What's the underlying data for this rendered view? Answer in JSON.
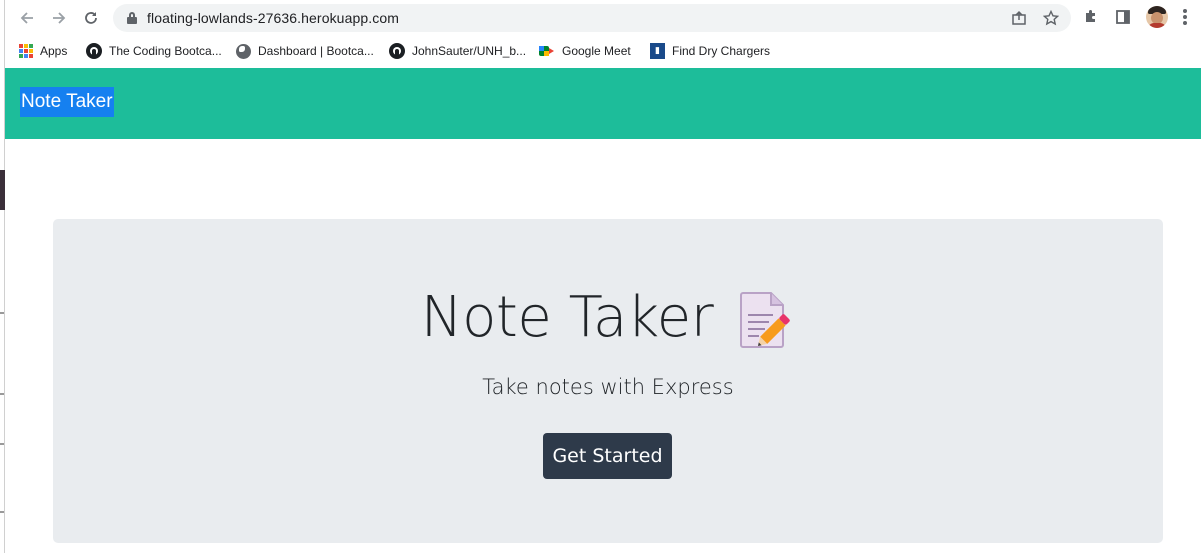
{
  "browser": {
    "url": "floating-lowlands-27636.herokuapp.com",
    "nav": {
      "back_icon": "back-arrow-icon",
      "forward_icon": "forward-arrow-icon",
      "reload_icon": "reload-icon"
    },
    "omnibox_icons": [
      "share-icon",
      "bookmark-star-icon"
    ],
    "toolbar_icons": [
      "extensions-icon",
      "side-panel-icon",
      "profile-avatar",
      "menu-icon"
    ]
  },
  "bookmarks": [
    {
      "label": "Apps",
      "icon": "apps-grid-icon"
    },
    {
      "label": "The Coding Bootca...",
      "icon": "github-icon"
    },
    {
      "label": "Dashboard | Bootca...",
      "icon": "globe-icon"
    },
    {
      "label": "JohnSauter/UNH_b...",
      "icon": "github-icon"
    },
    {
      "label": "Google Meet",
      "icon": "google-meet-icon"
    },
    {
      "label": "Find Dry Chargers",
      "icon": "dry-chargers-icon"
    }
  ],
  "app": {
    "navbar_brand": "Note Taker",
    "hero": {
      "title": "Note Taker",
      "icon": "memo-pencil-icon",
      "subtitle": "Take notes with Express",
      "button_label": "Get Started"
    }
  },
  "colors": {
    "navbar": "#1dbd9a",
    "brand_highlight": "#1580f0",
    "jumbotron": "#e9ecef",
    "button": "#2e3a4a"
  }
}
